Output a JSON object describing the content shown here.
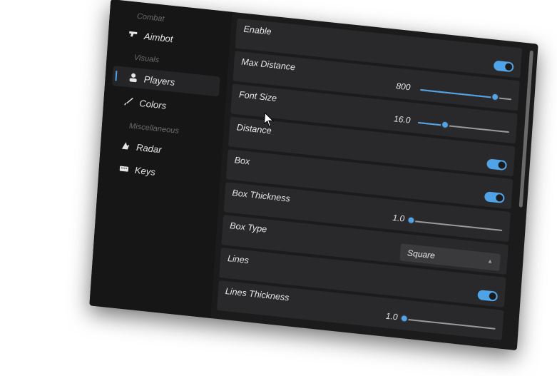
{
  "sidebar": {
    "groups": [
      {
        "label": "Combat"
      },
      {
        "label": "Visuals"
      },
      {
        "label": "Miscellaneous"
      }
    ],
    "items": [
      {
        "label": "Aimbot",
        "icon": "aimbot-icon",
        "active": false
      },
      {
        "label": "Players",
        "icon": "person-icon",
        "active": true
      },
      {
        "label": "Colors",
        "icon": "brush-icon",
        "active": false
      },
      {
        "label": "Radar",
        "icon": "radar-icon",
        "active": false
      },
      {
        "label": "Keys",
        "icon": "keyboard-icon",
        "active": false
      }
    ]
  },
  "settings": {
    "enable": {
      "label": "Enable",
      "on": true
    },
    "max_distance": {
      "label": "Max Distance",
      "value": "800",
      "fraction": 0.82
    },
    "font_size": {
      "label": "Font Size",
      "value": "16.0",
      "fraction": 0.3
    },
    "distance": {
      "label": "Distance",
      "on": true
    },
    "box": {
      "label": "Box",
      "on": true
    },
    "box_thickness": {
      "label": "Box Thickness",
      "value": "1.0",
      "fraction": 0.0
    },
    "box_type": {
      "label": "Box Type",
      "value": "Square"
    },
    "lines": {
      "label": "Lines",
      "on": true
    },
    "lines_thickness": {
      "label": "Lines Thickness",
      "value": "1.0",
      "fraction": 0.0
    }
  },
  "colors": {
    "accent": "#4fa3e6",
    "panel": "#1b1b1c",
    "row": "#29292b"
  }
}
